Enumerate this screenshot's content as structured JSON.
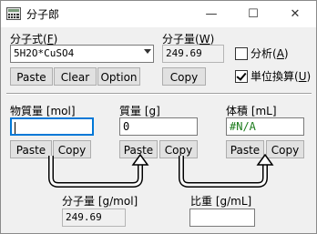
{
  "window": {
    "title": "分子郎",
    "minimize_glyph": "—",
    "maximize_glyph": "☐",
    "close_glyph": "✕"
  },
  "formula": {
    "label": "分子式(F)",
    "label_prefix": "分子式(",
    "label_key": "F",
    "label_suffix": ")",
    "value": "5H2O*CuSO4",
    "buttons": {
      "paste": "Paste",
      "clear": "Clear",
      "option": "Option"
    }
  },
  "molecular_weight": {
    "label_prefix": "分子量(",
    "label_key": "W",
    "label_suffix": ")",
    "value": "249.69",
    "copy": "Copy"
  },
  "options": {
    "analysis": {
      "prefix": "分析(",
      "key": "A",
      "suffix": ")",
      "checked": false
    },
    "unit_convert": {
      "prefix": "単位換算(",
      "key": "U",
      "suffix": ")",
      "checked": true
    }
  },
  "amount": {
    "label": "物質量 [mol]",
    "value": "",
    "paste": "Paste",
    "copy": "Copy"
  },
  "mass": {
    "label": "質量 [g]",
    "value": "0",
    "paste": "Paste",
    "copy": "Copy"
  },
  "volume": {
    "label": "体積 [mL]",
    "value": "#N/A",
    "paste": "Paste",
    "copy": "Copy"
  },
  "molar_mass": {
    "label": "分子量 [g/mol]",
    "value": "249.69"
  },
  "density": {
    "label": "比重 [g/mL]",
    "value": ""
  }
}
